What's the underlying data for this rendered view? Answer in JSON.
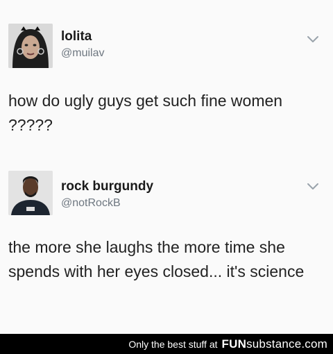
{
  "tweets": [
    {
      "name": "lolita",
      "handle": "@muilav",
      "text": "how do ugly guys get such fine women ?????"
    },
    {
      "name": "rock burgundy",
      "handle": "@notRockB",
      "text": "the more she laughs the more time she spends with her eyes closed...  it's science"
    }
  ],
  "footer": {
    "tagline": "Only the best stuff at",
    "brand_bold": "FUN",
    "brand_light": "substance",
    "brand_domain": ".com"
  },
  "icons": [
    "chevron-down-icon",
    "avatar"
  ]
}
